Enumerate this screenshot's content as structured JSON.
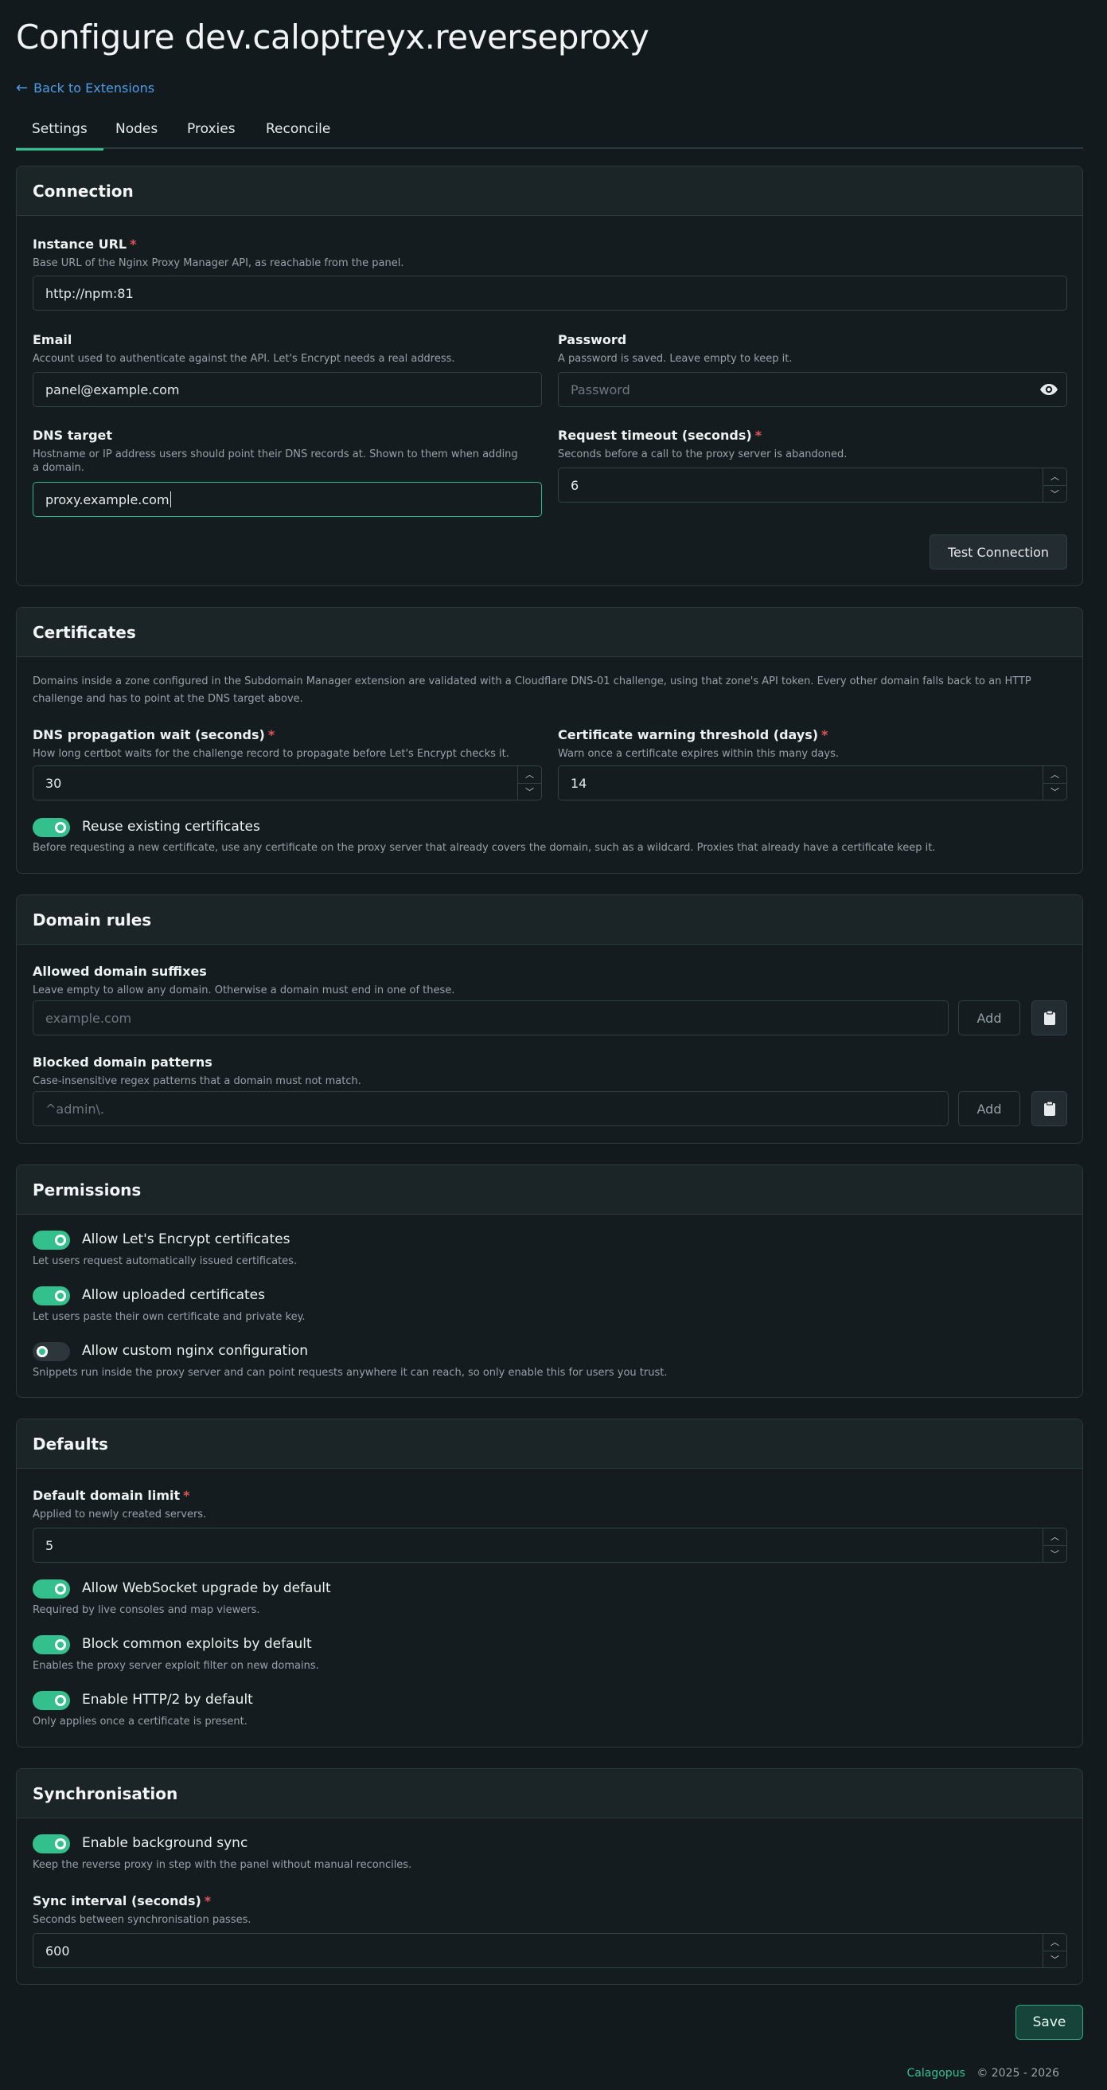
{
  "page": {
    "title": "Configure dev.caloptreyx.reverseproxy",
    "back_link": "Back to Extensions"
  },
  "tabs": [
    "Settings",
    "Nodes",
    "Proxies",
    "Reconcile"
  ],
  "connection": {
    "heading": "Connection",
    "instance_url": {
      "label": "Instance URL",
      "desc": "Base URL of the Nginx Proxy Manager API, as reachable from the panel.",
      "value": "http://npm:81"
    },
    "email": {
      "label": "Email",
      "desc": "Account used to authenticate against the API. Let's Encrypt needs a real address.",
      "value": "panel@example.com"
    },
    "password": {
      "label": "Password",
      "desc": "A password is saved. Leave empty to keep it.",
      "placeholder": "Password"
    },
    "dns_target": {
      "label": "DNS target",
      "desc_line1": "Hostname or IP address users should point their DNS records at. Shown to them when adding",
      "desc_line2": "a domain.",
      "value": "proxy.example.com"
    },
    "timeout": {
      "label": "Request timeout (seconds)",
      "desc": "Seconds before a call to the proxy server is abandoned.",
      "value": "6"
    },
    "test_button": "Test Connection"
  },
  "certificates": {
    "heading": "Certificates",
    "intro_line1": "Domains inside a zone configured in the Subdomain Manager extension are validated with a Cloudflare DNS-01 challenge, using that zone's API token. Every other domain falls back to an HTTP",
    "intro_line2": "challenge and has to point at the DNS target above.",
    "propagation": {
      "label": "DNS propagation wait (seconds)",
      "desc": "How long certbot waits for the challenge record to propagate before Let's Encrypt checks it.",
      "value": "30"
    },
    "warning": {
      "label": "Certificate warning threshold (days)",
      "desc": "Warn once a certificate expires within this many days.",
      "value": "14"
    },
    "reuse": {
      "label": "Reuse existing certificates",
      "desc": "Before requesting a new certificate, use any certificate on the proxy server that already covers the domain, such as a wildcard. Proxies that already have a certificate keep it.",
      "enabled": true
    }
  },
  "domain_rules": {
    "heading": "Domain rules",
    "allowed": {
      "label": "Allowed domain suffixes",
      "desc": "Leave empty to allow any domain. Otherwise a domain must end in one of these.",
      "placeholder": "example.com",
      "add": "Add"
    },
    "blocked": {
      "label": "Blocked domain patterns",
      "desc": "Case-insensitive regex patterns that a domain must not match.",
      "placeholder": "^admin\\.",
      "add": "Add"
    }
  },
  "permissions": {
    "heading": "Permissions",
    "letsencrypt": {
      "label": "Allow Let's Encrypt certificates",
      "desc": "Let users request automatically issued certificates.",
      "enabled": true
    },
    "uploaded": {
      "label": "Allow uploaded certificates",
      "desc": "Let users paste their own certificate and private key.",
      "enabled": true
    },
    "custom_nginx": {
      "label": "Allow custom nginx configuration",
      "desc": "Snippets run inside the proxy server and can point requests anywhere it can reach, so only enable this for users you trust.",
      "enabled": false
    }
  },
  "defaults": {
    "heading": "Defaults",
    "domain_limit": {
      "label": "Default domain limit",
      "desc": "Applied to newly created servers.",
      "value": "5"
    },
    "websocket": {
      "label": "Allow WebSocket upgrade by default",
      "desc": "Required by live consoles and map viewers.",
      "enabled": true
    },
    "exploits": {
      "label": "Block common exploits by default",
      "desc": "Enables the proxy server exploit filter on new domains.",
      "enabled": true
    },
    "http2": {
      "label": "Enable HTTP/2 by default",
      "desc": "Only applies once a certificate is present.",
      "enabled": true
    }
  },
  "sync": {
    "heading": "Synchronisation",
    "background": {
      "label": "Enable background sync",
      "desc": "Keep the reverse proxy in step with the panel without manual reconciles.",
      "enabled": true
    },
    "interval": {
      "label": "Sync interval (seconds)",
      "desc": "Seconds between synchronisation passes.",
      "value": "600"
    }
  },
  "save_button": "Save",
  "footer": {
    "brand": "Calagopus",
    "copyright": "© 2025 - 2026"
  },
  "colors": {
    "accent": "#34c08c",
    "link": "#4f9de6",
    "required": "#e25555",
    "background": "#131a1e"
  }
}
